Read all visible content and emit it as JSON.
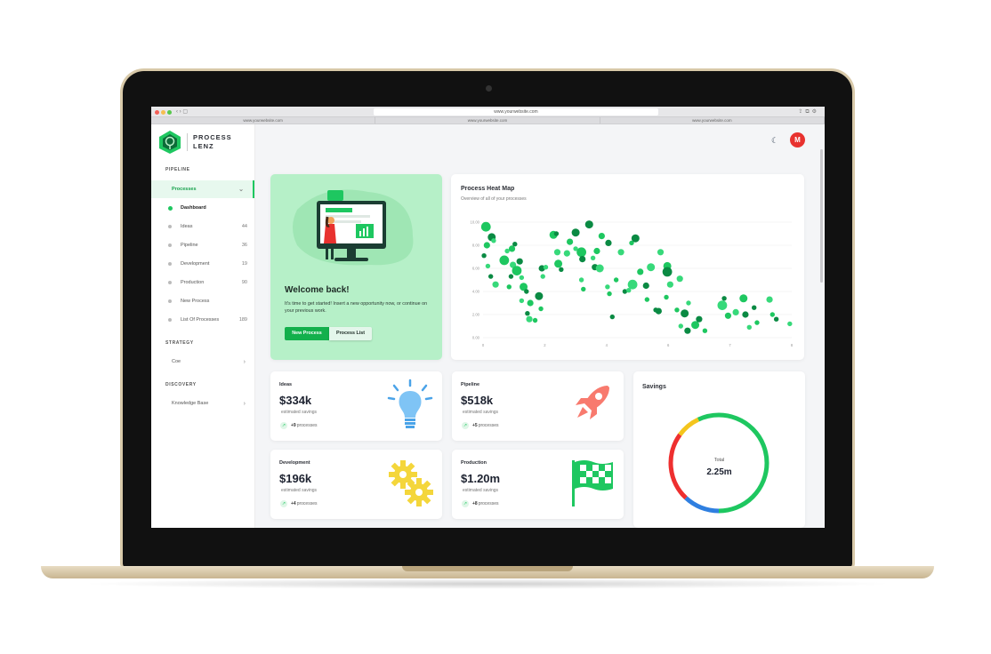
{
  "browser": {
    "url": "www.yourwebsite.com",
    "tabs": [
      "www.yourwebsite.com",
      "www.yourwebsite.com",
      "www.yourwebsite.com"
    ]
  },
  "brand": {
    "line1": "PROCESS",
    "line2": "LENZ",
    "color": "#1ec760"
  },
  "sidebar": {
    "sections": {
      "pipeline": "PIPELINE",
      "strategy": "STRATEGY",
      "discovery": "DISCOVERY"
    },
    "processes": "Processes",
    "items": [
      {
        "label": "Dashboard",
        "count": ""
      },
      {
        "label": "Ideas",
        "count": "44"
      },
      {
        "label": "Pipeline",
        "count": "36"
      },
      {
        "label": "Development",
        "count": "19"
      },
      {
        "label": "Production",
        "count": "90"
      },
      {
        "label": "New Process",
        "count": ""
      },
      {
        "label": "List Of Processes",
        "count": "189"
      }
    ],
    "coe": "Coe",
    "knowledge_base": "Knowledge Base"
  },
  "header": {
    "avatar_initial": "M",
    "theme_icon": "moon-icon"
  },
  "welcome": {
    "title": "Welcome back!",
    "text": "It's time to get started! Insert a new opportunity now, or continue on your previous work.",
    "new_process": "New Process",
    "process_list": "Process List"
  },
  "heatmap": {
    "title": "Process Heat Map",
    "subtitle": "Overview of all of your processes"
  },
  "chart_data": {
    "type": "scatter",
    "title": "Process Heat Map",
    "subtitle": "Overview of all of your processes",
    "xlim": [
      0,
      8
    ],
    "ylim": [
      0,
      10
    ],
    "xticks": [
      "0",
      "2",
      "4",
      "6",
      "7",
      "8"
    ],
    "yticks": [
      "0.00",
      "2.00",
      "4.00",
      "6.00",
      "8.00",
      "10.00"
    ],
    "grid": true,
    "colors": [
      "#1ec760",
      "#0a8a43",
      "#37d97a"
    ],
    "points": [
      [
        0.3,
        9.6,
        6
      ],
      [
        0.9,
        8.7,
        5
      ],
      [
        1.1,
        8.4,
        3
      ],
      [
        0.4,
        8.0,
        4
      ],
      [
        0.1,
        7.1,
        3
      ],
      [
        0.5,
        6.2,
        3
      ],
      [
        2.2,
        6.7,
        6
      ],
      [
        0.8,
        5.3,
        3
      ],
      [
        1.3,
        4.6,
        4
      ],
      [
        2.7,
        4.4,
        3
      ],
      [
        2.9,
        5.3,
        3
      ],
      [
        2.5,
        7.5,
        3
      ],
      [
        3.0,
        7.7,
        4
      ],
      [
        3.3,
        8.1,
        3
      ],
      [
        3.1,
        6.3,
        4
      ],
      [
        3.5,
        5.8,
        6
      ],
      [
        3.8,
        6.6,
        4
      ],
      [
        4.0,
        5.2,
        3
      ],
      [
        4.2,
        4.4,
        5
      ],
      [
        4.5,
        4.0,
        3
      ],
      [
        4.0,
        3.2,
        3
      ],
      [
        4.9,
        3.0,
        4
      ],
      [
        4.6,
        2.1,
        3
      ],
      [
        4.8,
        1.6,
        4
      ],
      [
        5.4,
        1.5,
        3
      ],
      [
        5.8,
        3.6,
        5
      ],
      [
        6.2,
        5.3,
        3
      ],
      [
        6.0,
        2.5,
        3
      ],
      [
        6.1,
        6.0,
        4
      ],
      [
        6.5,
        6.1,
        3
      ],
      [
        7.3,
        8.9,
        5
      ],
      [
        7.6,
        9.0,
        3
      ],
      [
        7.7,
        7.4,
        4
      ],
      [
        7.8,
        6.4,
        5
      ],
      [
        8.1,
        5.9,
        3
      ],
      [
        8.7,
        7.3,
        4
      ],
      [
        9.0,
        8.3,
        4
      ],
      [
        9.6,
        9.1,
        5
      ],
      [
        9.6,
        7.7,
        3
      ],
      [
        10.2,
        7.4,
        6
      ],
      [
        10.3,
        6.8,
        4
      ],
      [
        10.2,
        5.0,
        3
      ],
      [
        10.4,
        4.2,
        3
      ],
      [
        11.0,
        9.8,
        5
      ],
      [
        11.4,
        6.9,
        3
      ],
      [
        11.8,
        7.5,
        4
      ],
      [
        11.6,
        6.1,
        4
      ],
      [
        12.1,
        6.0,
        5
      ],
      [
        12.3,
        8.8,
        4
      ],
      [
        13.0,
        8.2,
        4
      ],
      [
        12.9,
        4.4,
        3
      ],
      [
        13.1,
        3.8,
        3
      ],
      [
        13.4,
        1.8,
        3
      ],
      [
        14.3,
        7.4,
        4
      ],
      [
        13.8,
        5.0,
        3
      ],
      [
        14.7,
        4.0,
        3
      ],
      [
        15.1,
        4.1,
        3
      ],
      [
        15.4,
        8.2,
        3
      ],
      [
        15.8,
        8.6,
        5
      ],
      [
        15.5,
        4.6,
        6
      ],
      [
        16.3,
        5.7,
        4
      ],
      [
        16.9,
        4.5,
        4
      ],
      [
        17.4,
        6.1,
        5
      ],
      [
        17.0,
        3.3,
        3
      ],
      [
        17.9,
        2.4,
        3
      ],
      [
        18.4,
        7.4,
        4
      ],
      [
        19.1,
        6.2,
        5
      ],
      [
        19.1,
        5.7,
        6
      ],
      [
        19.4,
        4.6,
        4
      ],
      [
        19.0,
        3.5,
        3
      ],
      [
        18.2,
        2.3,
        4
      ],
      [
        20.4,
        5.1,
        4
      ],
      [
        20.1,
        2.4,
        3
      ],
      [
        20.9,
        2.1,
        5
      ],
      [
        21.3,
        3.0,
        3
      ],
      [
        22.0,
        1.1,
        5
      ],
      [
        21.2,
        0.6,
        4
      ],
      [
        20.5,
        1.0,
        3
      ],
      [
        23.0,
        0.6,
        3
      ],
      [
        22.4,
        1.6,
        4
      ],
      [
        24.8,
        2.8,
        6
      ],
      [
        25.4,
        1.9,
        4
      ],
      [
        25.0,
        3.4,
        3
      ],
      [
        26.2,
        2.2,
        4
      ],
      [
        27.0,
        3.4,
        5
      ],
      [
        27.2,
        2.0,
        4
      ],
      [
        27.6,
        0.9,
        3
      ],
      [
        28.4,
        1.3,
        3
      ],
      [
        28.1,
        2.6,
        3
      ],
      [
        29.7,
        3.3,
        4
      ],
      [
        30.0,
        2.0,
        3
      ],
      [
        30.4,
        1.6,
        3
      ],
      [
        31.8,
        1.2,
        3
      ]
    ]
  },
  "stats": [
    {
      "title": "Ideas",
      "value": "$334k",
      "caption": "estimated savings",
      "trend": "+9",
      "trend_label": "processes",
      "icon": "lightbulb-icon",
      "color": "#4aa3e8"
    },
    {
      "title": "Pipeline",
      "value": "$518k",
      "caption": "estimated savings",
      "trend": "+5",
      "trend_label": "processes",
      "icon": "rocket-icon",
      "color": "#f87a6e"
    },
    {
      "title": "Development",
      "value": "$196k",
      "caption": "estimated savings",
      "trend": "+4",
      "trend_label": "processes",
      "icon": "gears-icon",
      "color": "#f4d63b"
    },
    {
      "title": "Production",
      "value": "$1.20m",
      "caption": "estimated savings",
      "trend": "+8",
      "trend_label": "processes",
      "icon": "checkered-flag-icon",
      "color": "#1ec760"
    }
  ],
  "savings": {
    "title": "Savings",
    "total_label": "Total",
    "total_value": "2.25m",
    "segments": [
      {
        "color": "#1ec760",
        "fraction": 0.5
      },
      {
        "color": "#2f7fe0",
        "fraction": 0.12
      },
      {
        "color": "#ee2f2f",
        "fraction": 0.23
      },
      {
        "color": "#f4c51d",
        "fraction": 0.08
      },
      {
        "color": "#1ec760",
        "fraction": 0.07
      }
    ]
  }
}
